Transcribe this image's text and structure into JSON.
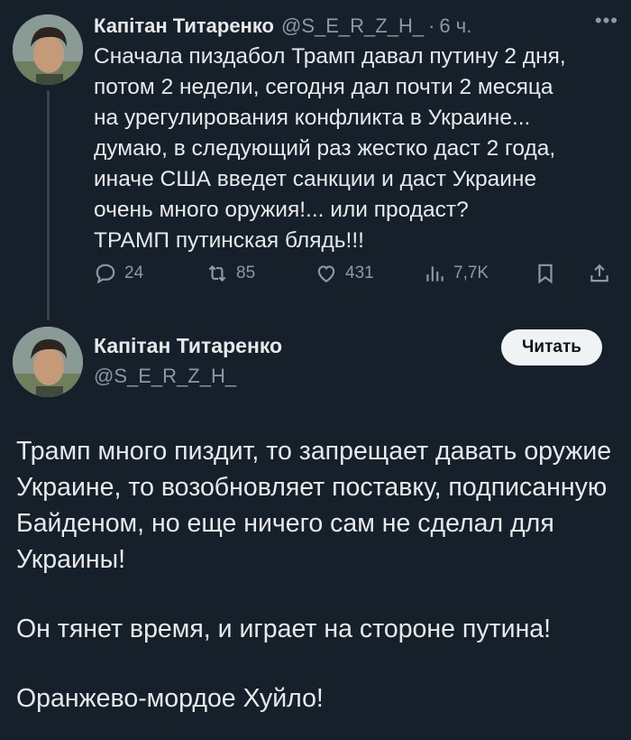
{
  "tweet1": {
    "display_name": "Капітан Титаренко",
    "handle": "@S_E_R_Z_H_",
    "separator": "·",
    "time": "6 ч.",
    "more_icon": "ellipsis-icon",
    "text": "Сначала пиздабол Трамп давал путину 2 дня,\nпотом 2 недели, сегодня дал почти 2 месяца\nна урегулирования конфликта в Украине...\nдумаю, в следующий раз жестко даст 2 года,\nиначе США введет санкции и даст Украине\nочень много оружия!... или продаст?\nТРАМП путинская блядь!!!",
    "actions": {
      "replies": "24",
      "retweets": "85",
      "likes": "431",
      "views": "7,7K"
    }
  },
  "tweet2": {
    "display_name": "Капітан Титаренко",
    "handle": "@S_E_R_Z_H_",
    "follow_label": "Читать",
    "paragraphs": [
      "Трамп много пиздит, то запрещает давать оружие Украине, то возобновляет поставку, подписанную Байденом, но еще ничего сам не сделал для Украины!",
      "Он тянет время, и играет на стороне путина!",
      "Оранжево-мордое Хуйло!"
    ]
  },
  "colors": {
    "background": "#15202b",
    "text": "#e7e9ea",
    "muted": "#8b98a5",
    "button_bg": "#eff3f4"
  }
}
